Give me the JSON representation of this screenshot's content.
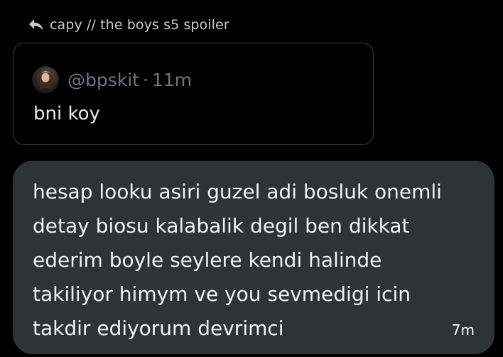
{
  "reply_context": {
    "icon": "reply-arrow-icon",
    "label": "capy // the boys s5 spoiler"
  },
  "quoted_post": {
    "avatar": "user-avatar",
    "handle": "@bpskit",
    "separator": "·",
    "time": "11m",
    "text": "bni koy"
  },
  "message": {
    "text": "hesap looku asiri guzel adi bosluk onemli\ndetay biosu kalabalik degil ben dikkat\nederim boyle seylere kendi halinde\ntakiliyor himym ve you sevmedigi icin\ntakdir ediyorum devrimci",
    "time": "7m"
  },
  "colors": {
    "background": "#000000",
    "bubble": "#2f3336",
    "muted_text": "#71767b",
    "card_border": "#3a3d41"
  }
}
